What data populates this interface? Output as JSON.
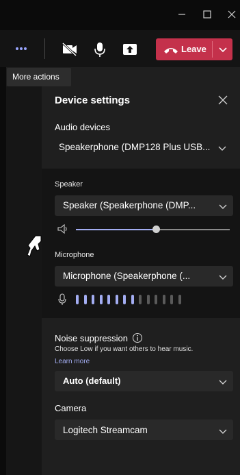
{
  "titlebar": {
    "minimize": "minimize-icon",
    "maximize": "maximize-icon",
    "close": "close-icon"
  },
  "callbar": {
    "more_actions_tooltip": "More actions",
    "leave_label": "Leave",
    "leave_color": "#c4314b",
    "icons": [
      "more-icon",
      "camera-off-icon",
      "microphone-icon",
      "share-screen-icon",
      "phone-hangup-icon",
      "chevron-down-icon"
    ]
  },
  "device_settings": {
    "title": "Device settings",
    "audio_devices": {
      "label": "Audio devices",
      "selected": "Speakerphone (DMP128 Plus USB..."
    },
    "speaker": {
      "label": "Speaker",
      "selected": "Speaker (Speakerphone (DMP...",
      "volume_fraction": 0.52
    },
    "microphone": {
      "label": "Microphone",
      "selected": "Microphone (Speakerphone (...",
      "level_bars_total": 14,
      "level_bars_active": 8
    },
    "noise_suppression": {
      "label": "Noise suppression",
      "help": "Choose Low if you want others to hear music.",
      "learn_more": "Learn more",
      "selected": "Auto (default)"
    },
    "camera": {
      "label": "Camera",
      "selected": "Logitech Streamcam"
    }
  },
  "colors": {
    "accent": "#a3adf2",
    "level_inactive": "#5a5a5a",
    "dropdown_bg": "#292929"
  }
}
